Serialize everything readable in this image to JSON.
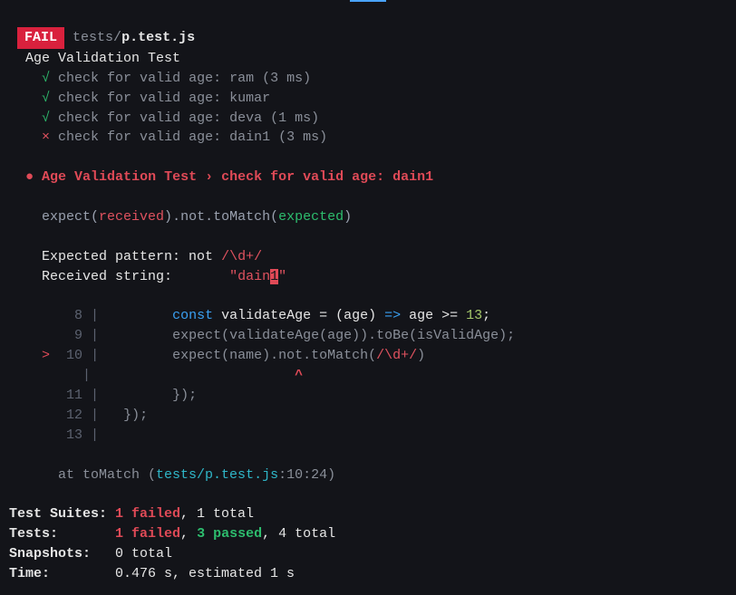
{
  "fail_badge": "FAIL",
  "file_dir": "tests/",
  "file_name": "p.test.js",
  "suite_title": "Age Validation Test",
  "checks": [
    {
      "mark": "√",
      "text": "check for valid age: ram (3 ms)",
      "status": "pass"
    },
    {
      "mark": "√",
      "text": "check for valid age: kumar",
      "status": "pass"
    },
    {
      "mark": "√",
      "text": "check for valid age: deva (1 ms)",
      "status": "pass"
    },
    {
      "mark": "×",
      "text": "check for valid age: dain1 (3 ms)",
      "status": "fail"
    }
  ],
  "failure_heading": "Age Validation Test › check for valid age: dain1",
  "expect_line": {
    "pre": "expect(",
    "received": "received",
    "mid1": ")",
    "not": ".not",
    "mid2": ".toMatch(",
    "expected": "expected",
    "post": ")"
  },
  "expected_label": "Expected pattern: not ",
  "expected_value": "/\\d+/",
  "received_label": "Received string:       ",
  "received_value_prefix": "\"dain",
  "received_value_highlight": "1",
  "received_value_suffix": "\"",
  "code": {
    "l8_num": "  8",
    "l8_a": "const",
    "l8_b": " validateAge = (age) ",
    "l8_c": "=>",
    "l8_d": " age >= ",
    "l8_e": "13",
    "l8_f": ";",
    "l9_num": "  9",
    "l9": "expect(validateAge(age)).toBe(isValidAge);",
    "l10_marker": ">",
    "l10_num": " 10",
    "l10_a": "expect(name).not.toMatch(",
    "l10_b": "/\\d+/",
    "l10_c": ")",
    "caret_line": "                        ",
    "caret": "^",
    "l11_num": " 11",
    "l11": "    });",
    "l12_num": " 12",
    "l12": "});",
    "l13_num": " 13"
  },
  "stack_pre": "at toMatch (",
  "stack_link": "tests/p.test.js",
  "stack_post": ":10:24)",
  "summary": {
    "suites_label": "Test Suites: ",
    "suites_fail": "1 failed",
    "suites_rest": ", 1 total",
    "tests_label": "Tests:       ",
    "tests_fail": "1 failed",
    "tests_sep": ", ",
    "tests_pass": "3 passed",
    "tests_rest": ", 4 total",
    "snapshots_label": "Snapshots:   ",
    "snapshots_rest": "0 total",
    "time_label": "Time:        ",
    "time_rest": "0.476 s, estimated 1 s"
  }
}
